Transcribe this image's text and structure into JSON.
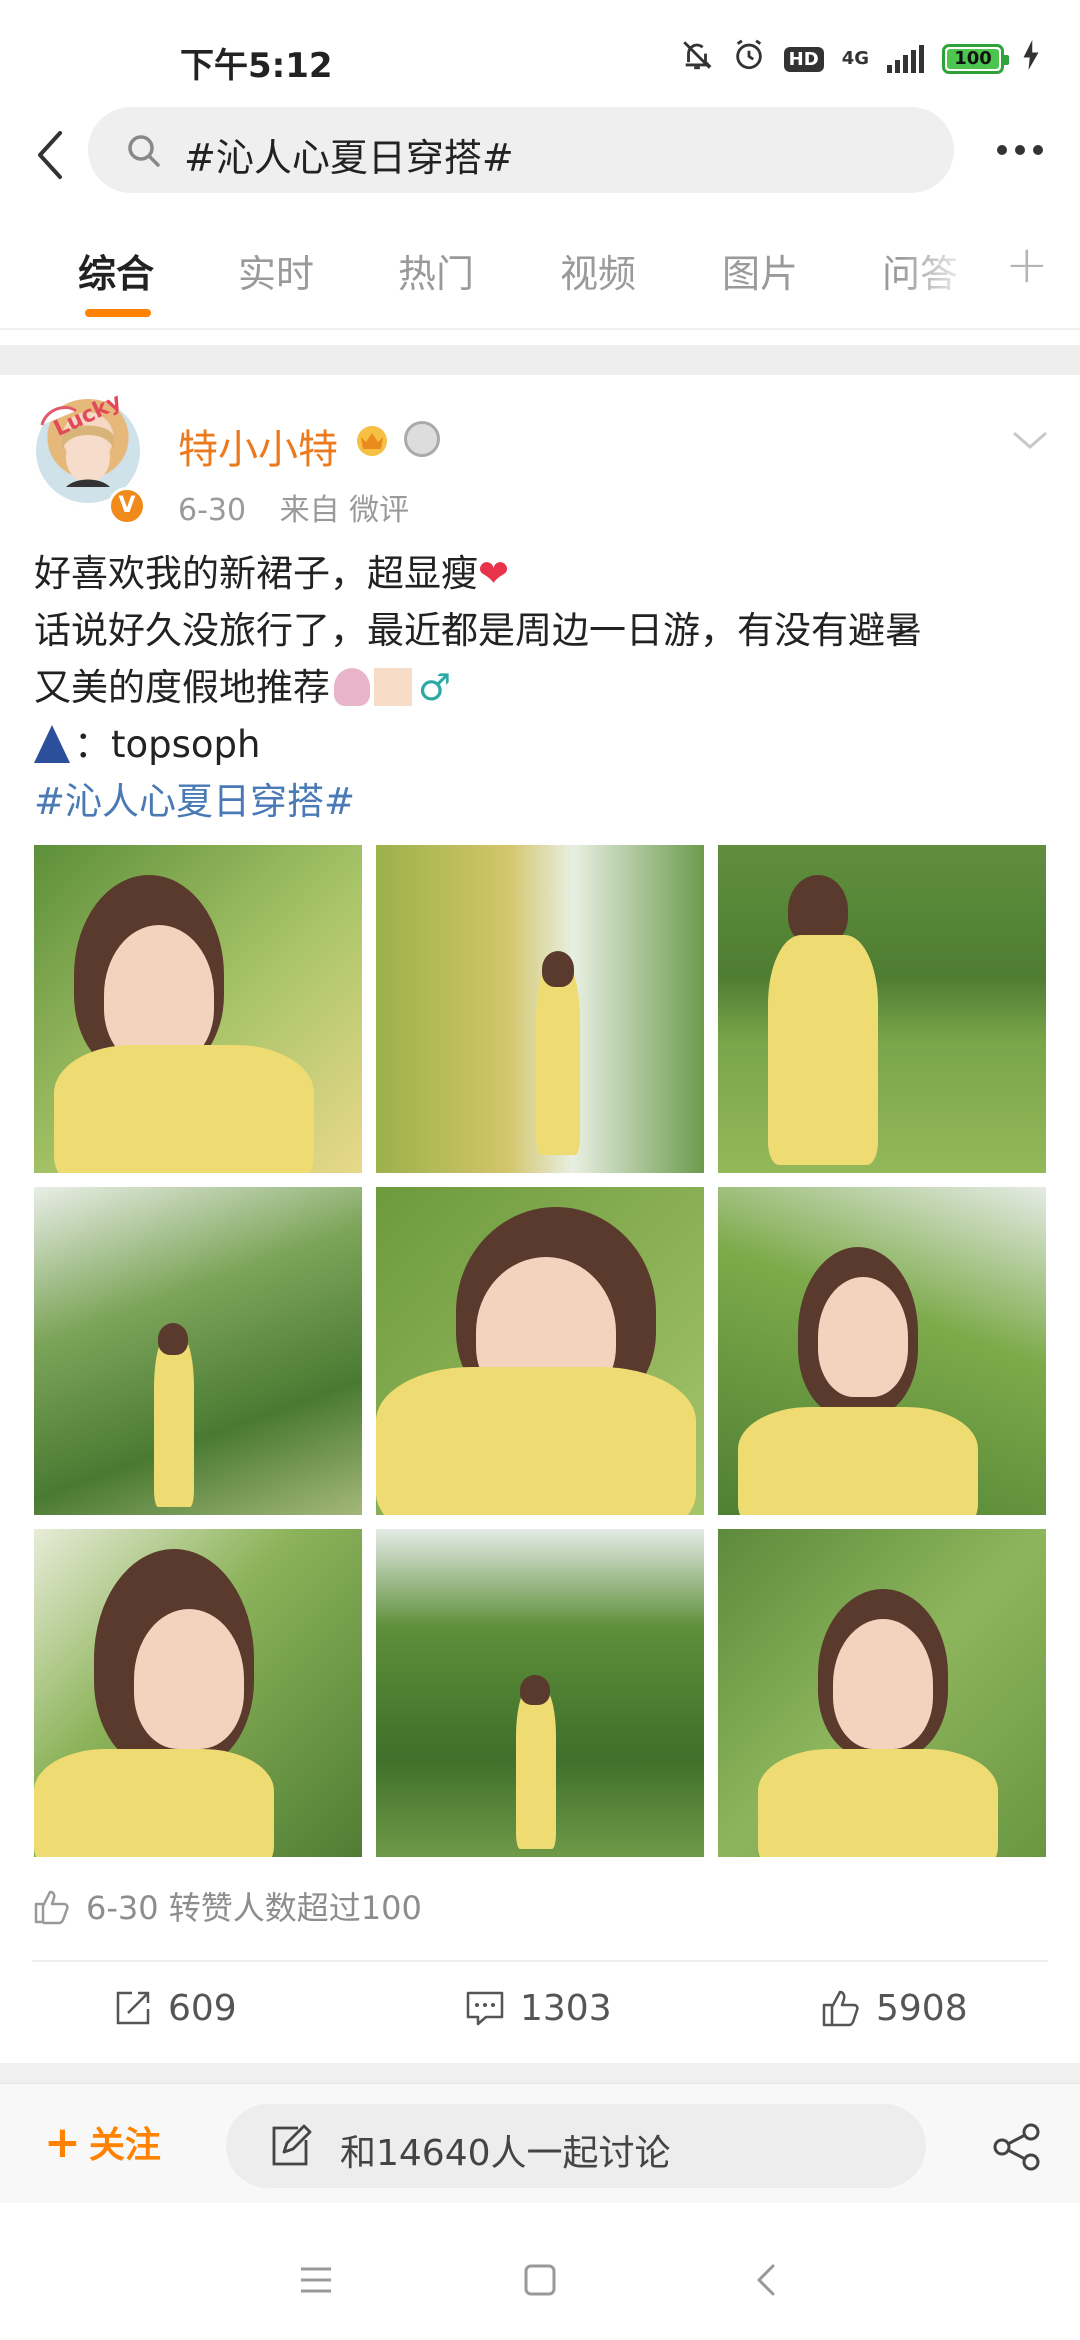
{
  "status_bar": {
    "time": "下午5:12",
    "hd": "HD",
    "network": "4G",
    "battery": "100",
    "battery_level": 1.0
  },
  "header": {
    "search_query": "#沁人心夏日穿搭#"
  },
  "tabs": [
    {
      "label": "综合",
      "active": true
    },
    {
      "label": "实时",
      "active": false
    },
    {
      "label": "热门",
      "active": false
    },
    {
      "label": "视频",
      "active": false
    },
    {
      "label": "图片",
      "active": false
    },
    {
      "label": "问答",
      "active": false
    }
  ],
  "post": {
    "avatar_frame_text": "Lucky",
    "username": "特小小特",
    "date": "6-30",
    "source": "来自 微评",
    "text_lines": [
      "好喜欢我的新裙子，超显瘦",
      "话说好久没旅行了，最近都是周边一日游，有没有避暑",
      "又美的度假地推荐",
      "：topsoph"
    ],
    "hashtag": "#沁人心夏日穿搭#",
    "likers_text": "6-30 转赞人数超过100",
    "reposts": "609",
    "comments": "1303",
    "likes": "5908"
  },
  "bottom_bar": {
    "follow_label": "关注",
    "discuss_label": "和14640人一起讨论"
  },
  "colors": {
    "accent": "#ff8200",
    "username": "#eb7a1e",
    "hashtag": "#4a7ab5",
    "text_secondary": "#9a9a9a"
  }
}
